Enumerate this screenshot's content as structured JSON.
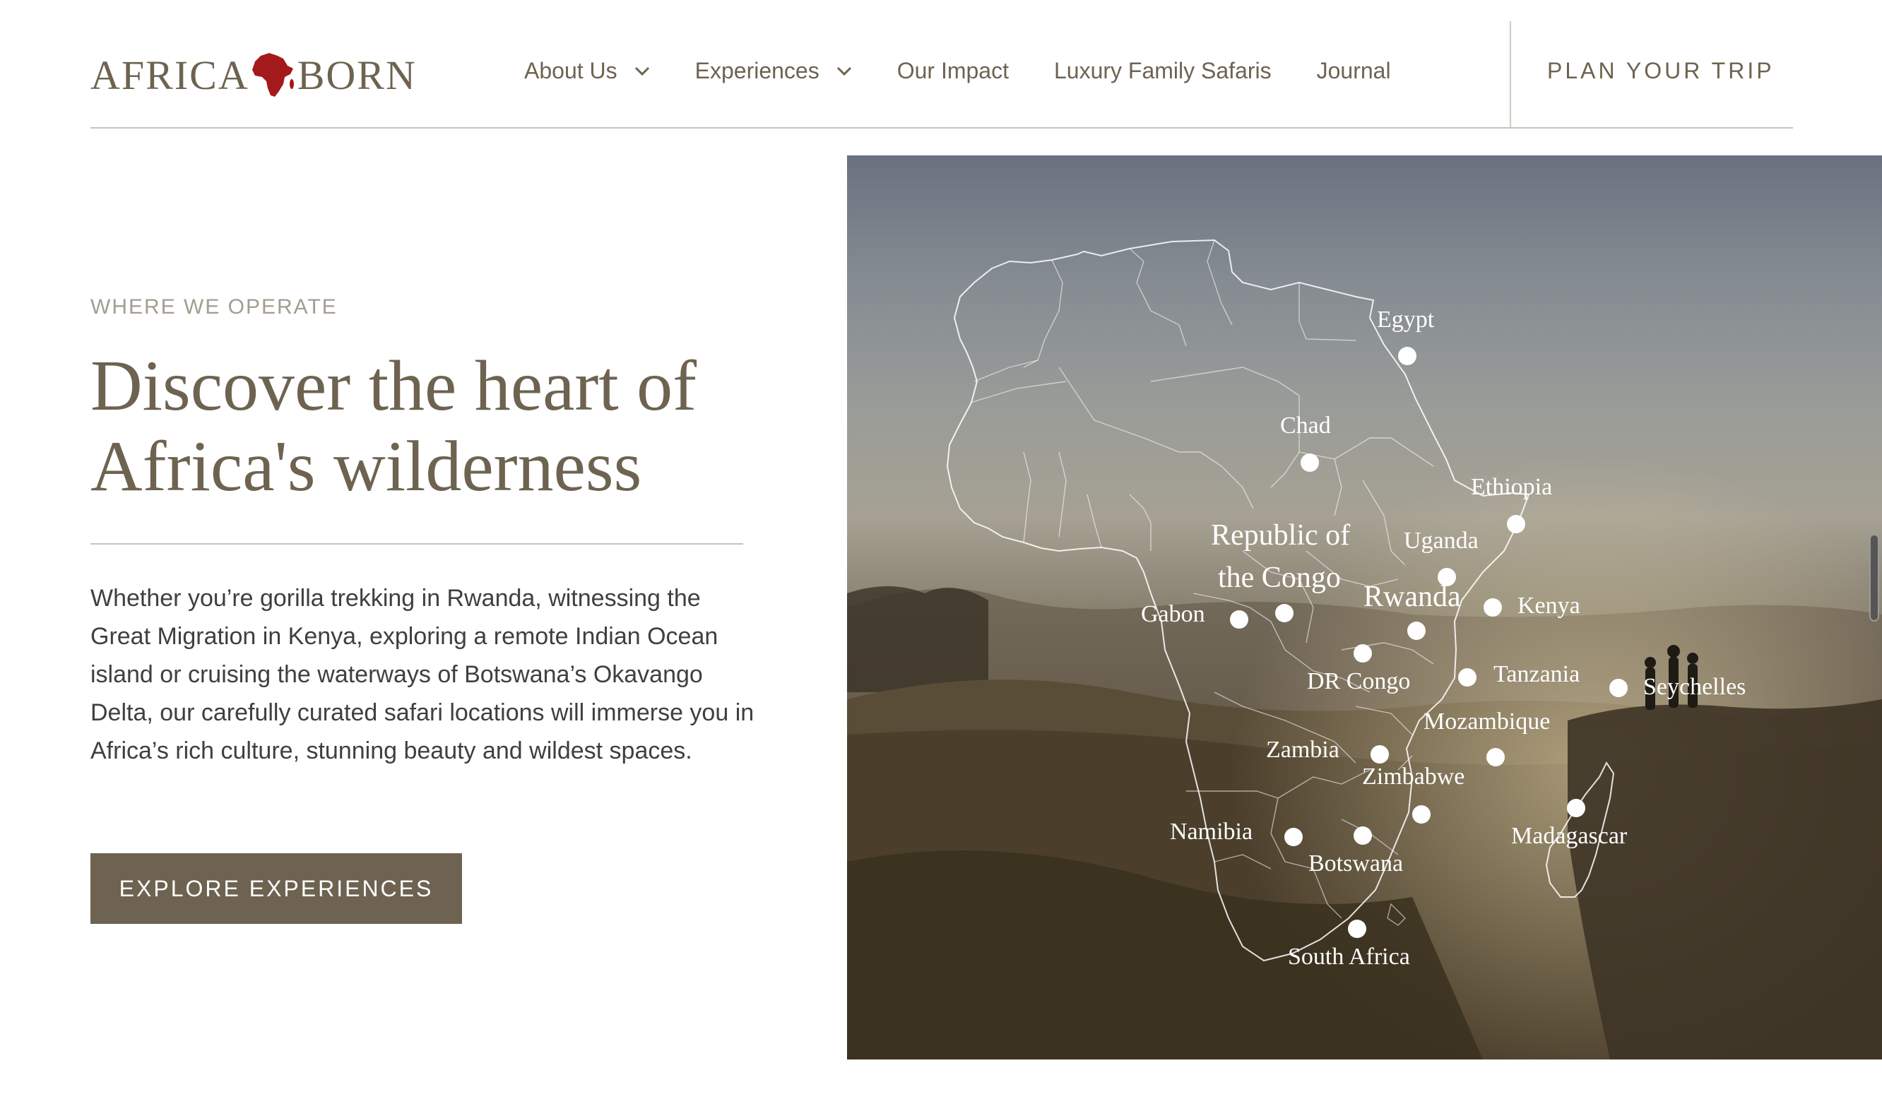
{
  "header": {
    "logo_left": "AFRICA",
    "logo_right": "BORN",
    "nav": [
      {
        "label": "About Us",
        "has_dropdown": true
      },
      {
        "label": "Experiences",
        "has_dropdown": true
      },
      {
        "label": "Our Impact",
        "has_dropdown": false
      },
      {
        "label": "Luxury Family Safaris",
        "has_dropdown": false
      },
      {
        "label": "Journal",
        "has_dropdown": false
      }
    ],
    "cta": "PLAN YOUR TRIP"
  },
  "hero": {
    "eyebrow": "WHERE WE OPERATE",
    "headline_line1": "Discover the heart of",
    "headline_line2": "Africa's wilderness",
    "body": "Whether you’re gorilla trekking in Rwanda, witnessing the Great Migration in Kenya, exploring a remote Indian Ocean island or cruising the waterways of Botswana’s Okavango Delta, our carefully curated safari locations will immerse you in Africa’s rich culture, stunning beauty and wildest spaces.",
    "button": "EXPLORE EXPERIENCES"
  },
  "map": {
    "locations": [
      {
        "name": "Egypt"
      },
      {
        "name": "Chad"
      },
      {
        "name": "Ethiopia"
      },
      {
        "name": "Republic of the Congo",
        "line1": "Republic of",
        "line2": "the Congo"
      },
      {
        "name": "Uganda"
      },
      {
        "name": "Gabon"
      },
      {
        "name": "Rwanda"
      },
      {
        "name": "Kenya"
      },
      {
        "name": "DR Congo"
      },
      {
        "name": "Tanzania"
      },
      {
        "name": "Seychelles"
      },
      {
        "name": "Mozambique"
      },
      {
        "name": "Zambia"
      },
      {
        "name": "Zimbabwe"
      },
      {
        "name": "Namibia"
      },
      {
        "name": "Botswana"
      },
      {
        "name": "Madagascar"
      },
      {
        "name": "South Africa"
      }
    ]
  },
  "colors": {
    "brand": "#6d6350",
    "logo_accent": "#a3191c",
    "rule": "#c9c4b8"
  }
}
